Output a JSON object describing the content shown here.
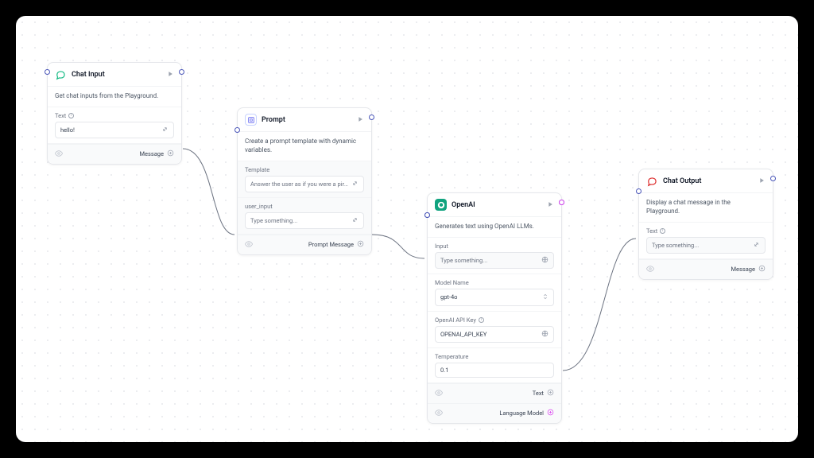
{
  "nodes": {
    "chat_input": {
      "title": "Chat Input",
      "desc": "Get chat inputs from the Playground.",
      "field_label": "Text",
      "value": "hello!",
      "output_label": "Message"
    },
    "prompt": {
      "title": "Prompt",
      "desc": "Create a prompt template with dynamic variables.",
      "template_label": "Template",
      "template_value": "Answer the user as if you were a pirate. U...",
      "user_input_label": "user_input",
      "user_input_placeholder": "Type something...",
      "output_label": "Prompt Message"
    },
    "openai": {
      "title": "OpenAI",
      "desc": "Generates text using OpenAI LLMs.",
      "input_label": "Input",
      "input_placeholder": "Type something...",
      "model_label": "Model Name",
      "model_value": "gpt-4o",
      "apikey_label": "OpenAI API Key",
      "apikey_value": "OPENAI_API_KEY",
      "temp_label": "Temperature",
      "temp_value": "0.1",
      "output_text": "Text",
      "output_lm": "Language Model"
    },
    "chat_output": {
      "title": "Chat Output",
      "desc": "Display a chat message in the Playground.",
      "field_label": "Text",
      "placeholder": "Type something...",
      "output_label": "Message"
    }
  }
}
